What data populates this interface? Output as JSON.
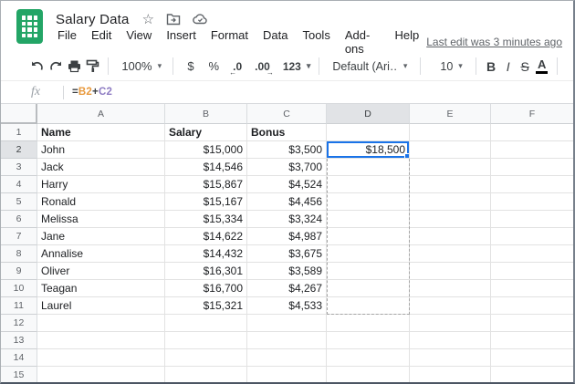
{
  "titlebar": {
    "title": "Salary Data",
    "star_glyph": "☆",
    "icons": [
      "star-icon",
      "move-to-folder-icon",
      "cloud-saved-icon"
    ]
  },
  "menubar": {
    "items": [
      "File",
      "Edit",
      "View",
      "Insert",
      "Format",
      "Data",
      "Tools",
      "Add-ons",
      "Help"
    ],
    "last_edit": "Last edit was 3 minutes ago"
  },
  "toolbar": {
    "zoom": "100%",
    "caret": "▾",
    "currency": "$",
    "percent": "%",
    "decrease_decimals": ".0",
    "decrease_arrow": "←",
    "increase_decimals": ".00",
    "increase_arrow": "→",
    "more_formats": "123",
    "font": "Default (Ari…",
    "font_size": "10",
    "bold": "B",
    "italic": "I",
    "strikethrough": "S",
    "text_color": "A"
  },
  "formula_bar": {
    "label": "fx",
    "tokens": [
      {
        "text": "=",
        "color": "#3c4043"
      },
      {
        "text": "B2",
        "color": "#e8993c"
      },
      {
        "text": "+",
        "color": "#3c4043"
      },
      {
        "text": "C2",
        "color": "#8e7cc3"
      }
    ]
  },
  "grid": {
    "row_header_width": 40,
    "columns": [
      {
        "letter": "A",
        "width": 140
      },
      {
        "letter": "B",
        "width": 90
      },
      {
        "letter": "C",
        "width": 87
      },
      {
        "letter": "D",
        "width": 91
      },
      {
        "letter": "E",
        "width": 89
      },
      {
        "letter": "F",
        "width": 93
      }
    ],
    "rows": [
      {
        "n": 1,
        "bold": true,
        "cells": [
          [
            "A",
            "Name",
            "left"
          ],
          [
            "B",
            "Salary",
            "left"
          ],
          [
            "C",
            "Bonus",
            "left"
          ]
        ]
      },
      {
        "n": 2,
        "cells": [
          [
            "A",
            "John",
            "left"
          ],
          [
            "B",
            "$15,000",
            "right"
          ],
          [
            "C",
            "$3,500",
            "right"
          ],
          [
            "D",
            "$18,500",
            "right"
          ]
        ]
      },
      {
        "n": 3,
        "cells": [
          [
            "A",
            "Jack",
            "left"
          ],
          [
            "B",
            "$14,546",
            "right"
          ],
          [
            "C",
            "$3,700",
            "right"
          ]
        ]
      },
      {
        "n": 4,
        "cells": [
          [
            "A",
            "Harry",
            "left"
          ],
          [
            "B",
            "$15,867",
            "right"
          ],
          [
            "C",
            "$4,524",
            "right"
          ]
        ]
      },
      {
        "n": 5,
        "cells": [
          [
            "A",
            "Ronald",
            "left"
          ],
          [
            "B",
            "$15,167",
            "right"
          ],
          [
            "C",
            "$4,456",
            "right"
          ]
        ]
      },
      {
        "n": 6,
        "cells": [
          [
            "A",
            "Melissa",
            "left"
          ],
          [
            "B",
            "$15,334",
            "right"
          ],
          [
            "C",
            "$3,324",
            "right"
          ]
        ]
      },
      {
        "n": 7,
        "cells": [
          [
            "A",
            "Jane",
            "left"
          ],
          [
            "B",
            "$14,622",
            "right"
          ],
          [
            "C",
            "$4,987",
            "right"
          ]
        ]
      },
      {
        "n": 8,
        "cells": [
          [
            "A",
            "Annalise",
            "left"
          ],
          [
            "B",
            "$14,432",
            "right"
          ],
          [
            "C",
            "$3,675",
            "right"
          ]
        ]
      },
      {
        "n": 9,
        "cells": [
          [
            "A",
            "Oliver",
            "left"
          ],
          [
            "B",
            "$16,301",
            "right"
          ],
          [
            "C",
            "$3,589",
            "right"
          ]
        ]
      },
      {
        "n": 10,
        "cells": [
          [
            "A",
            "Teagan",
            "left"
          ],
          [
            "B",
            "$16,700",
            "right"
          ],
          [
            "C",
            "$4,267",
            "right"
          ]
        ]
      },
      {
        "n": 11,
        "cells": [
          [
            "A",
            "Laurel",
            "left"
          ],
          [
            "B",
            "$15,321",
            "right"
          ],
          [
            "C",
            "$4,533",
            "right"
          ]
        ]
      },
      {
        "n": 12,
        "cells": []
      },
      {
        "n": 13,
        "cells": []
      },
      {
        "n": 14,
        "cells": []
      },
      {
        "n": 15,
        "cells": []
      }
    ],
    "selection": {
      "col": "D",
      "row": 2,
      "value": "$18,500"
    },
    "fill_preview": {
      "col": "D",
      "from_row": 3,
      "to_row": 11
    }
  },
  "colors": {
    "accent_blue": "#1a73e8",
    "logo_green": "#23a566",
    "header_bg": "#f8f9fa",
    "header_selected_bg": "#e1e3e6",
    "gridline": "#e2e2e2",
    "ref1_orange": "#e8993c",
    "ref2_purple": "#8e7cc3"
  }
}
